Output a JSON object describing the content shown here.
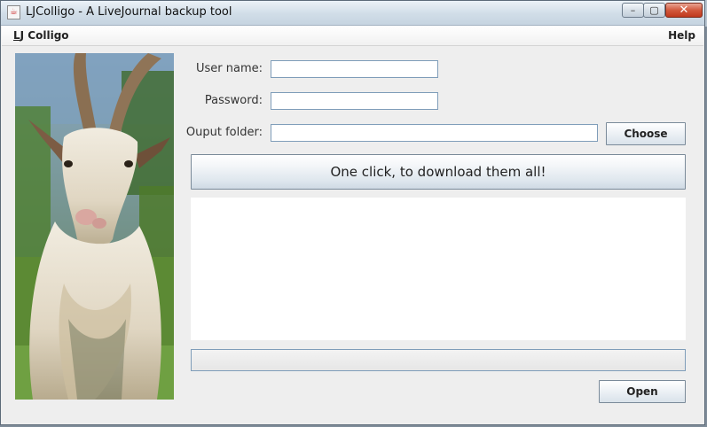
{
  "window": {
    "title": "LJColligo - A LiveJournal backup tool",
    "controls": {
      "minimize": "–",
      "maximize": "▢",
      "close": "✕"
    }
  },
  "menubar": {
    "app_menu_mnemonic": "L",
    "app_menu_rest": "J Colligo",
    "help": "Help"
  },
  "form": {
    "username_label": "User name:",
    "username_value": "",
    "password_label": "Password:",
    "password_value": "",
    "output_label": "Ouput folder:",
    "output_value": "",
    "choose_button": "Choose",
    "download_button": "One click, to download them all!"
  },
  "log": {
    "text": ""
  },
  "progress": {
    "value": 0
  },
  "footer": {
    "open_button": "Open"
  },
  "icons": {
    "app": "java-cup-icon",
    "image": "goat-photo"
  },
  "colors": {
    "field_border": "#7f9db9",
    "close_button": "#c0391d",
    "window_bg": "#eeeeee"
  }
}
